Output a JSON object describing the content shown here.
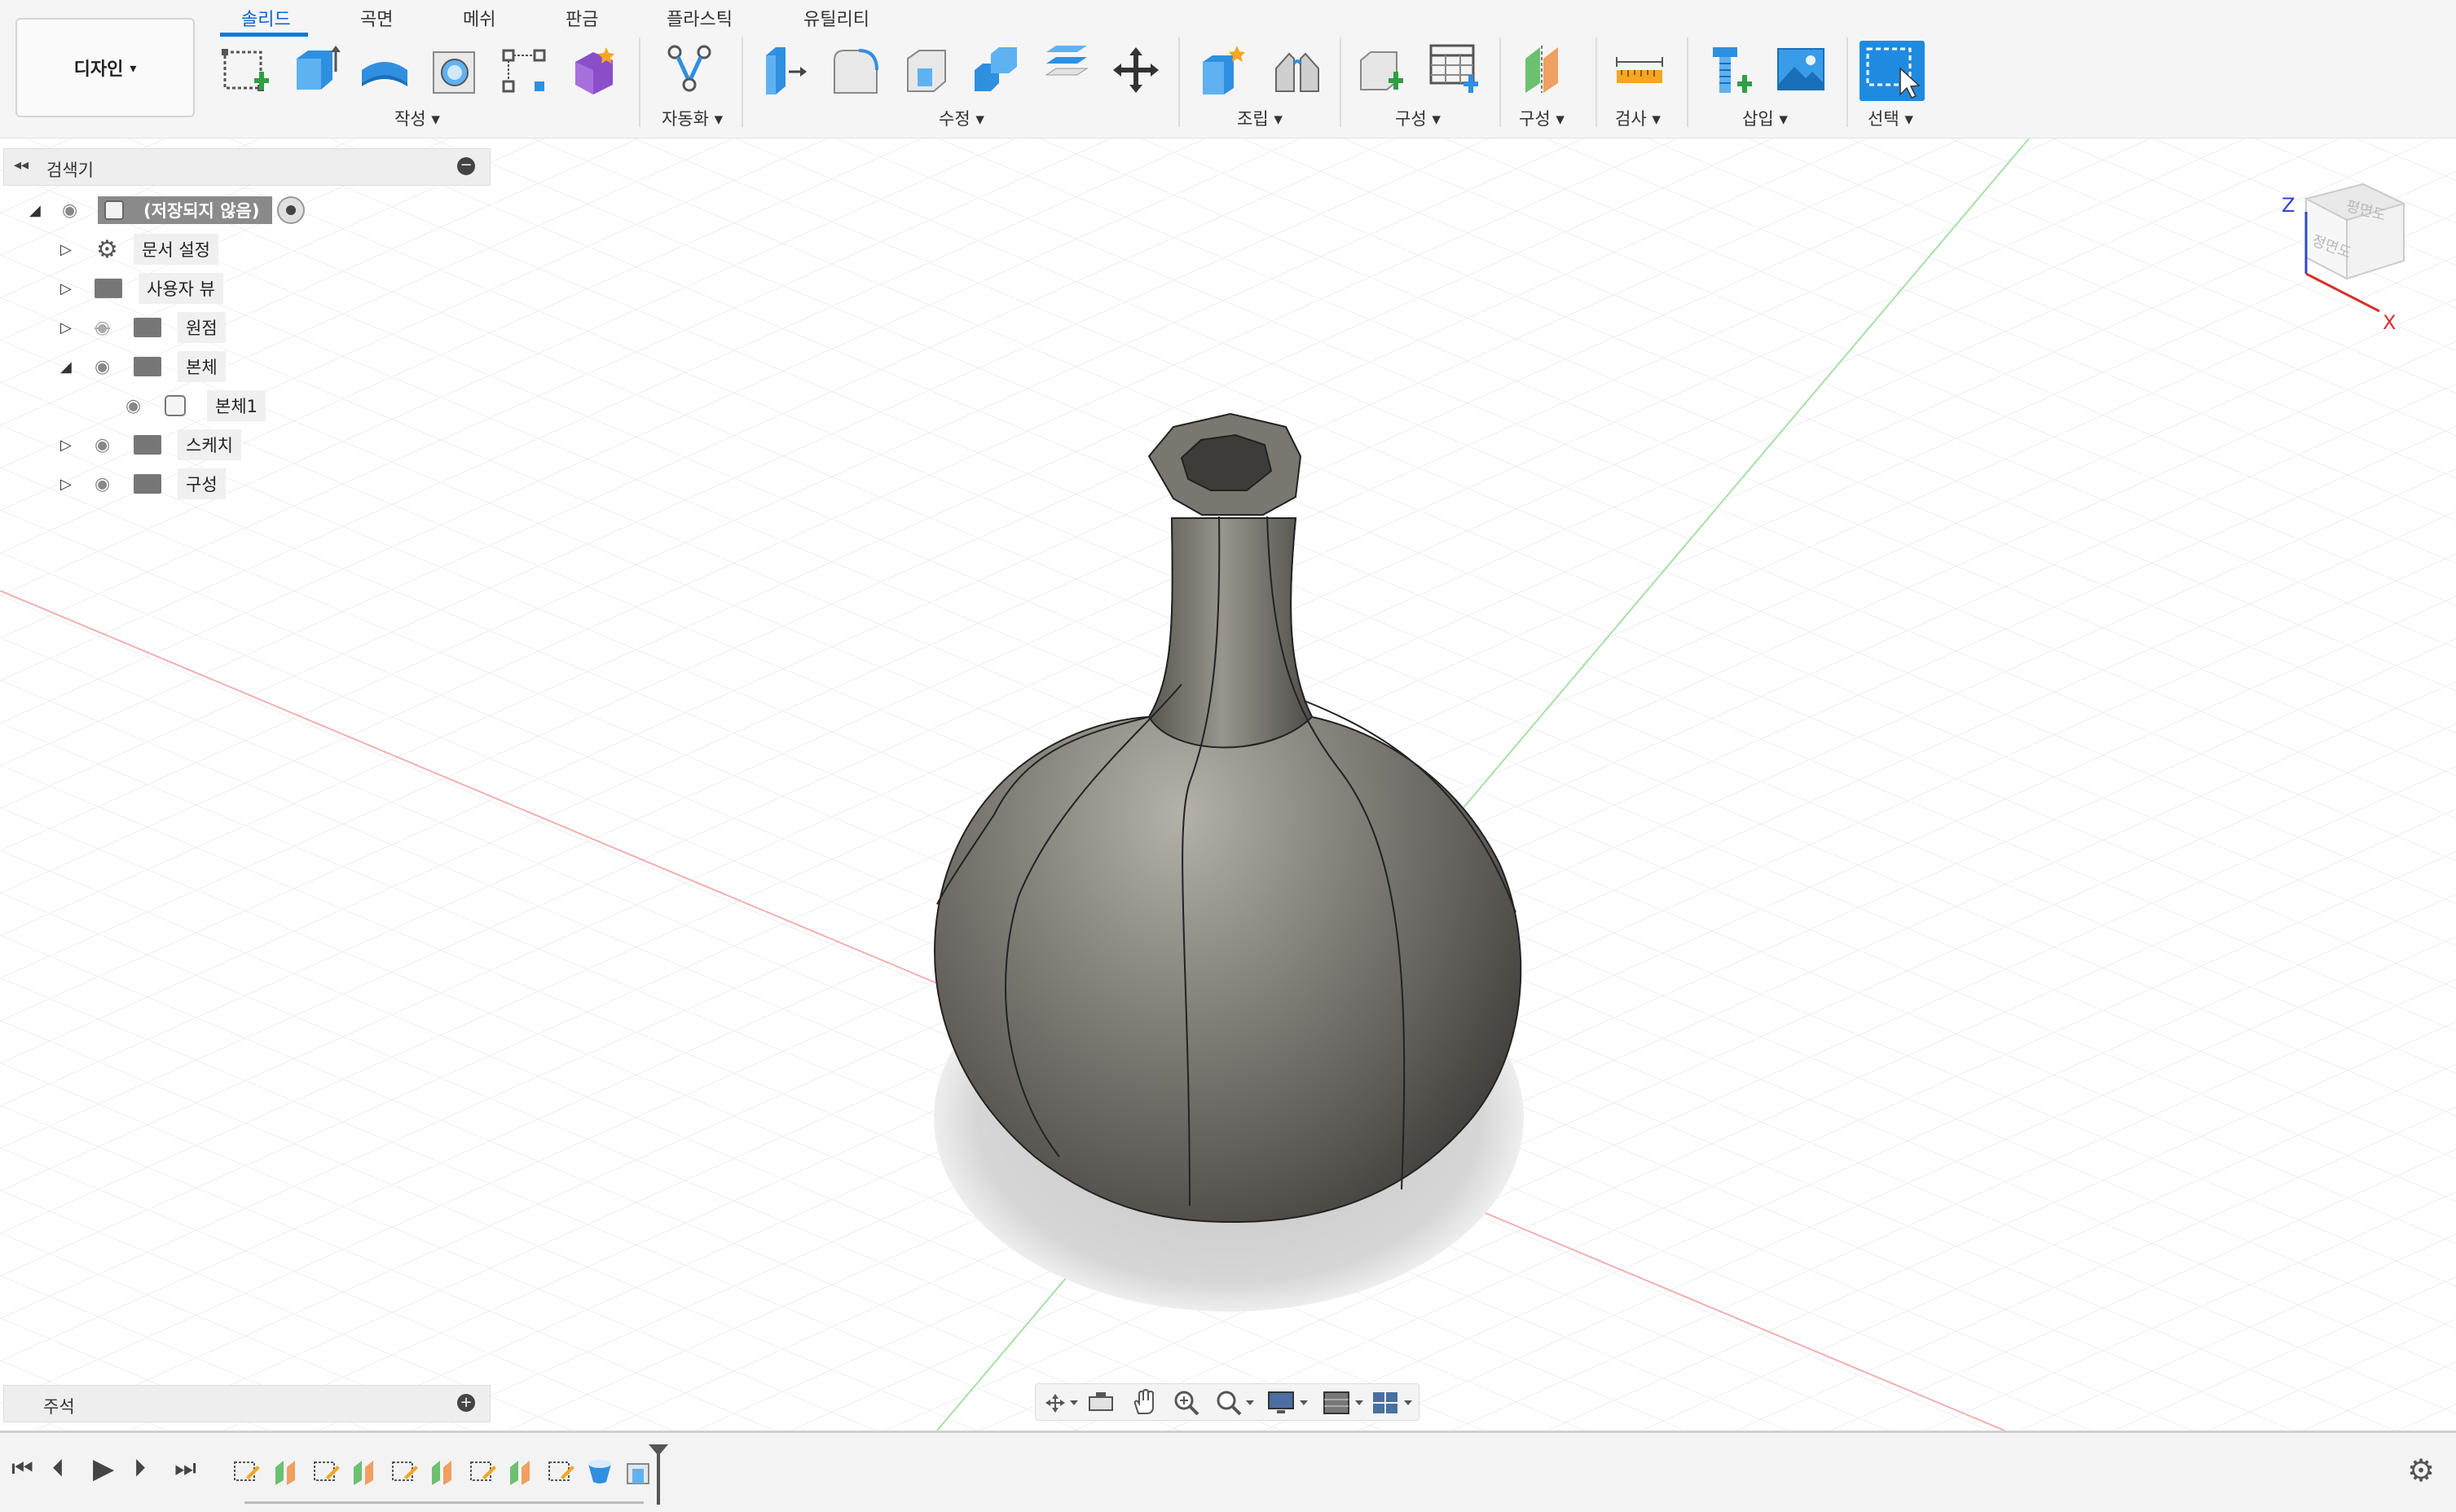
{
  "workspace": {
    "label": "디자인"
  },
  "tabs": [
    {
      "label": "솔리드",
      "active": true
    },
    {
      "label": "곡면"
    },
    {
      "label": "메쉬"
    },
    {
      "label": "판금"
    },
    {
      "label": "플라스틱"
    },
    {
      "label": "유틸리티"
    }
  ],
  "groups": {
    "create": "작성",
    "automate": "자동화",
    "modify": "수정",
    "assemble": "조립",
    "construct1": "구성",
    "construct2": "구성",
    "inspect": "검사",
    "insert": "삽입",
    "select": "선택"
  },
  "browser": {
    "title": "검색기",
    "root": "(저장되지 않음)",
    "items": [
      {
        "label": "문서 설정"
      },
      {
        "label": "사용자 뷰"
      },
      {
        "label": "원점"
      },
      {
        "label": "본체"
      },
      {
        "label": "본체1"
      },
      {
        "label": "스케치"
      },
      {
        "label": "구성"
      }
    ]
  },
  "notes": {
    "title": "주석"
  },
  "viewcube": {
    "axis_z": "Z",
    "axis_x": "X",
    "top_face": "평면도",
    "front_face": "정면도"
  },
  "colors": {
    "accent": "#0a7ad8",
    "select_blue": "#1f8be0",
    "body_color": "#6b6862"
  }
}
